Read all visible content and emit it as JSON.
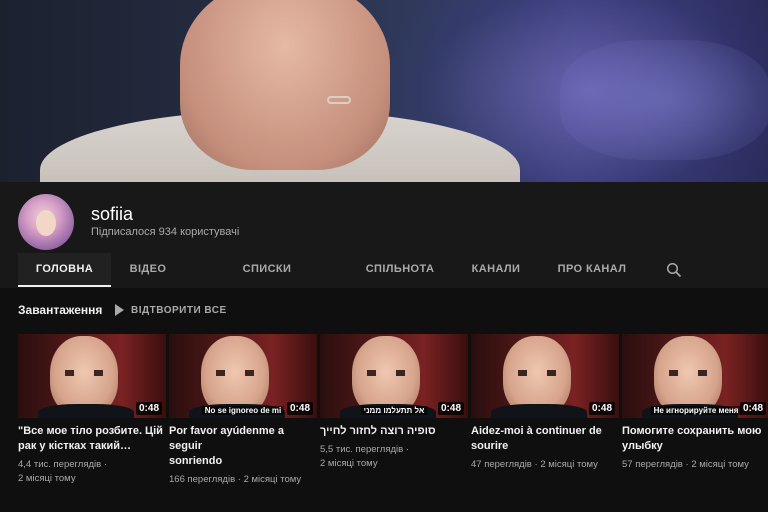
{
  "channel": {
    "name": "sofiia",
    "subscribers": "Підписалося 934 користувачі"
  },
  "tabs": [
    {
      "label": "ГОЛОВНА",
      "active": true
    },
    {
      "label": "ВІДЕО",
      "active": false
    },
    {
      "label": "СПИСКИ ВІДТВОРЕННЯ",
      "active": false
    },
    {
      "label": "СПІЛЬНОТА",
      "active": false
    },
    {
      "label": "КАНАЛИ",
      "active": false
    },
    {
      "label": "ПРО КАНАЛ",
      "active": false
    }
  ],
  "shelf": {
    "title": "Завантаження",
    "play_all": "ВІДТВОРИТИ ВСЕ"
  },
  "videos": [
    {
      "title_line1": "\"Все мое тіло розбите. Цій",
      "title_line2": "рак у кістках такий…",
      "duration": "0:48",
      "subtitle": "",
      "views": "4,4 тис. переглядів",
      "sep": "·",
      "age": "2 місяці тому"
    },
    {
      "title_line1": "Por favor ayúdenme a seguir",
      "title_line2": "sonriendo",
      "duration": "0:48",
      "subtitle": "No se ignoreo de mi",
      "views": "166 переглядів",
      "sep": "·",
      "age": "2 місяці тому"
    },
    {
      "title_line1": "סופיה רוצה לחזור לחייך",
      "title_line2": "",
      "duration": "0:48",
      "subtitle": "אל תתעלמו ממני",
      "views": "5,5 тис. переглядів",
      "sep": "·",
      "age": "2 місяці тому"
    },
    {
      "title_line1": "Aidez-moi à continuer de",
      "title_line2": "sourire",
      "duration": "0:48",
      "subtitle": "",
      "views": "47 переглядів",
      "sep": "·",
      "age": "2 місяці тому"
    },
    {
      "title_line1": "Помогите сохранить мою",
      "title_line2": "улыбку",
      "duration": "0:48",
      "subtitle": "Не игнорируйте меня",
      "views": "57 переглядів",
      "sep": "·",
      "age": "2 місяці тому"
    }
  ],
  "icons": {
    "search": "search-icon",
    "play": "play-icon"
  },
  "colors": {
    "background": "#181818",
    "content_background": "#0f0f0f",
    "text_primary": "#f1f1f1",
    "text_secondary": "#aaaaaa"
  }
}
